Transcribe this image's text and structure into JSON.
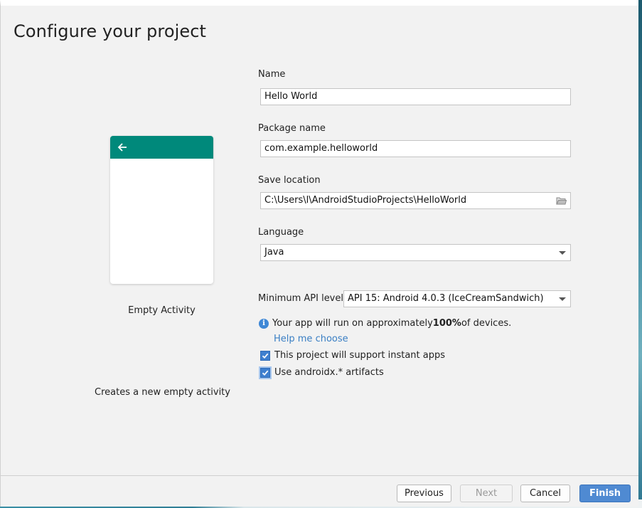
{
  "dialog": {
    "title": "Configure your project"
  },
  "template": {
    "name": "Empty Activity",
    "description": "Creates a new empty activity"
  },
  "form": {
    "name_label": "Name",
    "name_value": "Hello World",
    "package_label": "Package name",
    "package_value": "com.example.helloworld",
    "save_label": "Save location",
    "save_value": "C:\\Users\\l\\AndroidStudioProjects\\HelloWorld",
    "language_label": "Language",
    "language_value": "Java",
    "min_api_label": "Minimum API level",
    "min_api_value": "API 15: Android 4.0.3 (IceCreamSandwich)",
    "info_prefix": "Your app will run on approximately ",
    "info_percent": "100%",
    "info_suffix": " of devices.",
    "help_link": "Help me choose",
    "instant_apps_label": "This project will support instant apps",
    "instant_apps_checked": true,
    "androidx_label": "Use androidx.* artifacts",
    "androidx_checked": true
  },
  "buttons": {
    "previous": "Previous",
    "next": "Next",
    "cancel": "Cancel",
    "finish": "Finish"
  },
  "colors": {
    "accent": "#00897b",
    "primary_button": "#4f8ad2",
    "link": "#3a7fc4"
  }
}
